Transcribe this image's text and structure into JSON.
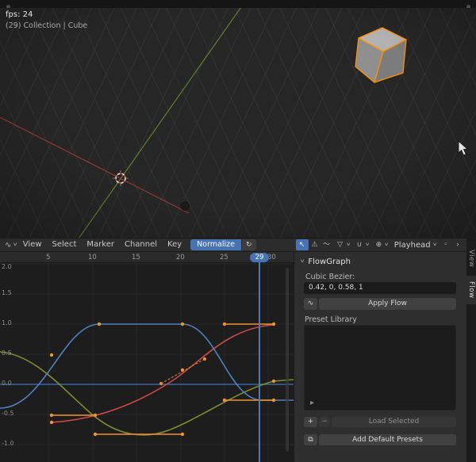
{
  "viewport": {
    "fps": "fps: 24",
    "breadcrumb": "(29) Collection | Cube"
  },
  "header": {
    "menus": [
      "View",
      "Select",
      "Marker",
      "Channel",
      "Key"
    ],
    "normalize": "Normalize",
    "playhead": "Playhead"
  },
  "ruler": {
    "ticks": [
      "5",
      "10",
      "15",
      "20",
      "25",
      "30"
    ],
    "current_frame": "29"
  },
  "graph": {
    "value_ticks": [
      "2.0",
      "1.5",
      "1.0",
      "0.5",
      "0.0",
      "-0.5",
      "-1.0"
    ]
  },
  "panel": {
    "title": "FlowGraph",
    "cubic_bezier_label": "Cubic Bezier:",
    "bezier_value": "0.42, 0, 0.58, 1",
    "apply": "Apply Flow",
    "preset_library": "Preset Library",
    "load_selected": "Load Selected",
    "add_defaults": "Add Default Presets"
  },
  "tabs": {
    "view": "View",
    "flow": "Flow"
  },
  "icons": {
    "editor": "∿",
    "chevron_down": "∨",
    "refresh": "↻",
    "pointer": "↖",
    "warning": "⚠",
    "wave": "〜",
    "filter": "▽",
    "snap": "∪",
    "overlay": "⊕",
    "dot": "◦",
    "chevron_right": "›",
    "play": "▶",
    "plus": "+",
    "minus": "−",
    "page": "⧉",
    "curve": "∿"
  },
  "colors": {
    "accent": "#4772b3",
    "keyframe_orange": "#ef9331",
    "curve_blue": "#4e80c0",
    "curve_red": "#cf4a45",
    "curve_olive": "#7f8c2f",
    "cube_outline": "#ff9100"
  }
}
